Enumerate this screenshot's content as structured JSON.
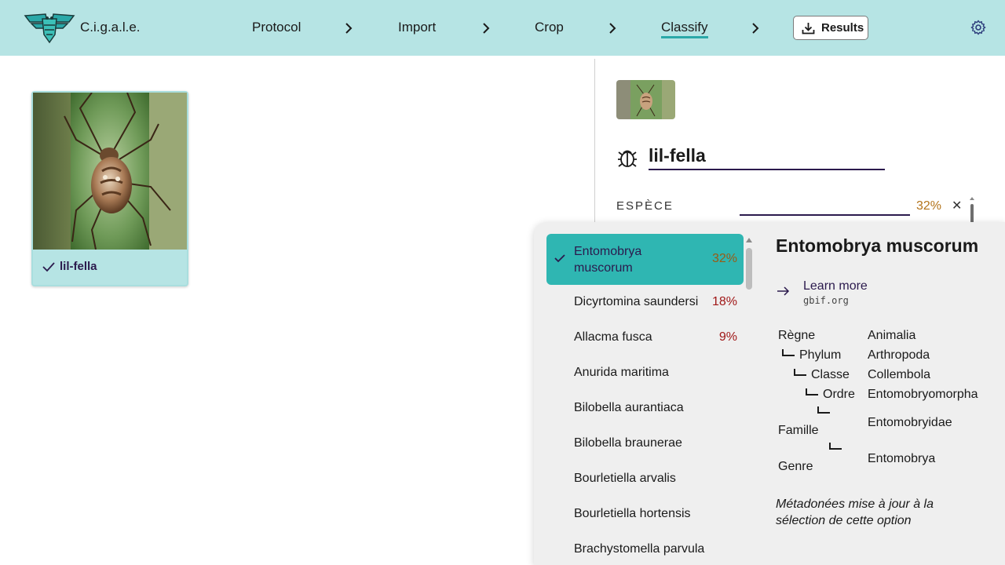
{
  "app": {
    "brand": "C.i.g.a.l.e."
  },
  "nav": {
    "steps": [
      {
        "label": "Protocol"
      },
      {
        "label": "Import"
      },
      {
        "label": "Crop"
      },
      {
        "label": "Classify",
        "active": true
      }
    ],
    "results_label": "Results"
  },
  "gallery": {
    "cards": [
      {
        "label": "lil-fella",
        "done": true
      }
    ]
  },
  "observation": {
    "name": "lil-fella",
    "espece_label": "ESPÈCE",
    "espece_value": "",
    "espece_confidence": "32%"
  },
  "dropdown": {
    "options": [
      {
        "name_line1": "Entomobrya",
        "name_line2": "muscorum",
        "pct": "32%",
        "selected": true
      },
      {
        "name": "Dicyrtomina saundersi",
        "pct": "18%"
      },
      {
        "name": "Allacma fusca",
        "pct": "9%"
      },
      {
        "name": "Anurida maritima",
        "pct": ""
      },
      {
        "name": "Bilobella aurantiaca",
        "pct": ""
      },
      {
        "name": "Bilobella braunerae",
        "pct": ""
      },
      {
        "name": "Bourletiella arvalis",
        "pct": ""
      },
      {
        "name": "Bourletiella hortensis",
        "pct": ""
      },
      {
        "name": "Brachystomella parvula",
        "pct": ""
      }
    ],
    "detail": {
      "title": "Entomobrya muscorum",
      "learn_more": "Learn more",
      "learn_url": "gbif.org",
      "taxonomy": {
        "regne": {
          "label": "Règne",
          "value": "Animalia"
        },
        "phylum": {
          "label": "Phylum",
          "value": "Arthropoda"
        },
        "classe": {
          "label": "Classe",
          "value": "Collembola"
        },
        "ordre": {
          "label": "Ordre",
          "value": "Entomobryomorpha"
        },
        "famille": {
          "label": "Famille",
          "value": "Entomobryidae"
        },
        "genre": {
          "label": "Genre",
          "value": "Entomobrya"
        }
      },
      "note": "Métadonées mise à jour à la sélection de cette option"
    }
  },
  "colors": {
    "topbar": "#b6e4e4",
    "accent": "#2fb6b2",
    "ink": "#2b1a4d",
    "pct_high": "#b3731a",
    "pct_low": "#a01818"
  }
}
